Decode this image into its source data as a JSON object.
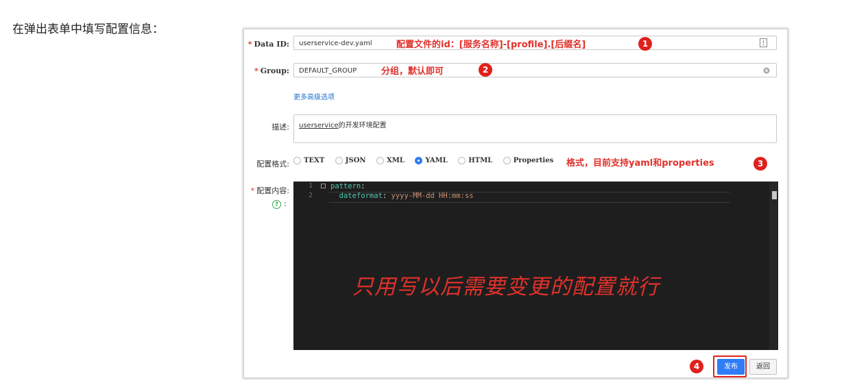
{
  "intro": "在弹出表单中填写配置信息：",
  "form": {
    "data_id": {
      "label": "Data ID:",
      "value": "userservice-dev.yaml"
    },
    "group": {
      "label": "Group:",
      "value": "DEFAULT_GROUP"
    },
    "advanced_link": "更多高级选项",
    "description": {
      "label": "描述:",
      "value_underlined": "userservice",
      "value_rest": "的开发环境配置"
    },
    "format": {
      "label": "配置格式:",
      "options": [
        "TEXT",
        "JSON",
        "XML",
        "YAML",
        "HTML",
        "Properties"
      ],
      "selected": "YAML"
    },
    "content": {
      "label": "配置内容:",
      "colon": ":",
      "help_symbol": "?",
      "lines": [
        {
          "num": "1",
          "key": "pattern",
          "sep": ":",
          "val": ""
        },
        {
          "num": "2",
          "key": "  dateformat",
          "sep": ": ",
          "val": "yyyy-MM-dd HH:mm:ss"
        }
      ]
    },
    "publish_label": "发布",
    "back_label": "返回"
  },
  "annotations": {
    "a1": "配置文件的id：[服务名称]-[profile].[后缀名]",
    "a2": "分组，默认即可",
    "a3": "格式，目前支持yaml和properties",
    "overlay": "只用写以后需要变更的配置就行",
    "badges": [
      "1",
      "2",
      "3",
      "4"
    ]
  },
  "colors": {
    "accent": "#2f7df6",
    "annotation_red": "#e0312b",
    "editor_bg": "#1e1e1e"
  }
}
